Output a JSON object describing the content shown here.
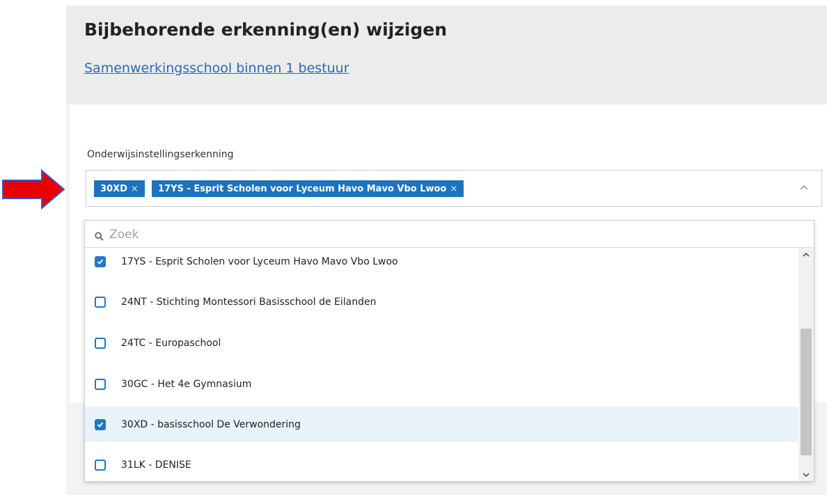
{
  "header": {
    "title": "Bijbehorende erkenning(en) wijzigen",
    "link": "Samenwerkingsschool binnen 1 bestuur"
  },
  "field": {
    "label": "Onderwijsinstellingserkenning",
    "selected_tags": [
      {
        "label": "30XD",
        "remove": "×"
      },
      {
        "label": "17YS - Esprit Scholen voor Lyceum Havo Mavo Vbo Lwoo",
        "remove": "×"
      }
    ]
  },
  "dropdown": {
    "search_placeholder": "Zoek",
    "search_value": "",
    "options": [
      {
        "label": "17YS - Esprit Scholen voor Lyceum Havo Mavo Vbo Lwoo",
        "checked": true
      },
      {
        "label": "24NT - Stichting Montessori Basisschool de Eilanden",
        "checked": false
      },
      {
        "label": "24TC - Europaschool",
        "checked": false
      },
      {
        "label": "30GC - Het 4e Gymnasium",
        "checked": false
      },
      {
        "label": "30XD - basisschool De Verwondering",
        "checked": true
      },
      {
        "label": "31LK - DENISE",
        "checked": false
      }
    ]
  },
  "colors": {
    "accent": "#1d73be",
    "link": "#2a6ab2",
    "highlight_row": "#e9f1f9",
    "annotation_arrow": "#e00000"
  },
  "icons": {
    "search": "search-icon",
    "chevron_up": "chevron-up-icon",
    "scroll_up": "scroll-up-icon",
    "scroll_down": "scroll-down-icon",
    "checkmark": "check-icon",
    "annotation": "red-arrow-icon"
  }
}
